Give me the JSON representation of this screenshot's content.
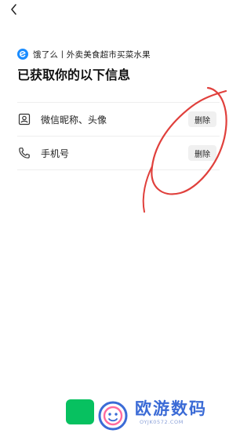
{
  "nav": {
    "back_icon": "chevron-left-icon"
  },
  "app": {
    "name": "饿了么丨外卖美食超市买菜水果",
    "logo_icon": "eleme-logo-icon",
    "logo_color": "#1a8cff"
  },
  "heading": "已获取你的以下信息",
  "permissions": [
    {
      "icon": "contact-card-icon",
      "label": "微信昵称、头像",
      "action": "删除"
    },
    {
      "icon": "phone-icon",
      "label": "手机号",
      "action": "删除"
    }
  ],
  "annotation": {
    "color": "#e0403c",
    "shape": "hand-drawn-circle"
  },
  "bottom": {
    "button_color": "#07c160"
  },
  "watermark": {
    "logo_icon": "watermark-logo-icon",
    "text": "欧游数码",
    "url": "OYJK0572.COM",
    "color": "#3b6bd6"
  }
}
